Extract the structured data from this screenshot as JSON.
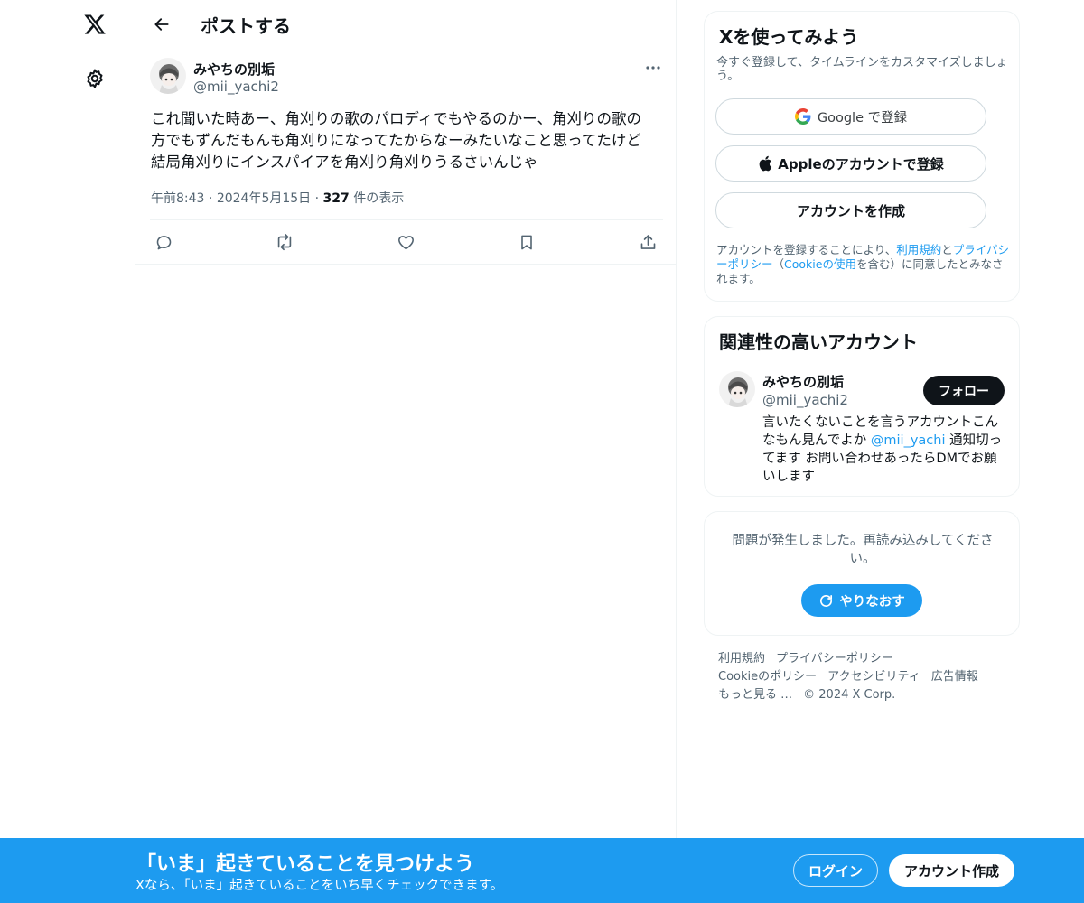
{
  "nav": {
    "logo_icon": "x-logo-icon",
    "settings_icon": "gear-icon"
  },
  "topbar": {
    "title": "ポストする",
    "back_icon": "arrow-left-icon"
  },
  "post": {
    "author_name": "みやちの別垢",
    "author_handle": "@mii_yachi2",
    "text": "これ聞いた時あー、角刈りの歌のパロディでもやるのかー、角刈りの歌の\n方でもずんだもんも角刈りになってたからなーみたいなこと思ってたけど\n結局角刈りにインスパイアを角刈り角刈りうるさいんじゃ",
    "time": "午前8:43",
    "date": "2024年5月15日",
    "views": "327",
    "views_suffix": "件の表示",
    "actions": [
      "reply-icon",
      "repost-icon",
      "like-icon",
      "bookmark-icon",
      "share-icon"
    ]
  },
  "signup_card": {
    "title": "Xを使ってみよう",
    "subtitle": "今すぐ登録して、タイムラインをカスタマイズしましょう。",
    "google_label": "Google で登録",
    "apple_label": "Appleのアカウントで登録",
    "create_label": "アカウントを作成",
    "legal_prefix": "アカウントを登録することにより、",
    "legal_terms": "利用規約",
    "legal_and": "と",
    "legal_privacy": "プライバシーポリシー",
    "legal_paren_open": "（",
    "legal_cookie": "Cookieの使用",
    "legal_suffix": "を含む）に同意したとみなされます。"
  },
  "recommend": {
    "title": "関連性の高いアカウント",
    "name": "みやちの別垢",
    "handle": "@mii_yachi2",
    "follow_label": "フォロー",
    "bio_prefix": "言いたくないことを言うアカウントこんなもん見んでよか ",
    "bio_mention": "@mii_yachi",
    "bio_suffix": " 通知切ってます お問い合わせあったらDMでお願いします"
  },
  "error_card": {
    "message": "問題が発生しました。再読み込みしてください。",
    "retry_label": "やりなおす"
  },
  "footer": {
    "links": [
      "利用規約",
      "プライバシーポリシー",
      "Cookieのポリシー",
      "アクセシビリティ",
      "広告情報",
      "もっと見る …",
      "© 2024 X Corp."
    ]
  },
  "banner": {
    "title": "「いま」起きていることを見つけよう",
    "subtitle": "Xなら、「いま」起きていることをいち早くチェックできます。",
    "login_label": "ログイン",
    "signup_label": "アカウント作成"
  },
  "colors": {
    "accent": "#1d9bf0",
    "text": "#0f1419",
    "secondary": "#536471",
    "border": "#eff3f4"
  }
}
